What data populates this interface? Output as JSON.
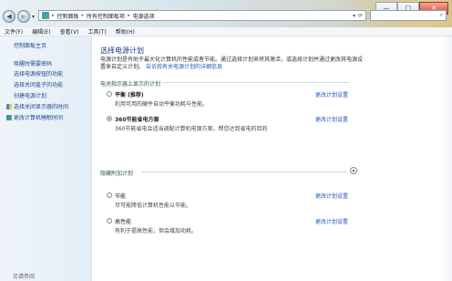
{
  "address_bar": {
    "crumbs": [
      "控制面板",
      "所有控制面板项",
      "电源选项"
    ],
    "refresh_glyph": "⟳"
  },
  "search": {
    "icon": "search-icon",
    "glyph": "⌕"
  },
  "window_controls": {
    "minimize": "—",
    "maximize": "□",
    "close": "✕"
  },
  "nav": {
    "back": "◀",
    "forward": "▶",
    "dropdown": "▾"
  },
  "menu": [
    "文件(F)",
    "编辑(E)",
    "查看(V)",
    "工具(T)",
    "帮助(H)"
  ],
  "sidebar": {
    "home": "控制面板主页",
    "items": [
      "唤醒时需要密码",
      "选择电源按钮的功能",
      "选择关闭盖子的功能",
      "创建电源计划"
    ],
    "icon_items": [
      "选择关闭显示器的时间",
      "更改计算机睡眠时间"
    ],
    "see_also": "另请参阅"
  },
  "main": {
    "title": "选择电源计划",
    "intro": "电源计划是有助于最大化计算机的性能或者节能。通过选择计划来将其激活，或选择计划并通过更改其电源设置来自定义计划。",
    "intro_link": "告诉我有关电源计划的详细信息",
    "section1": "电池指示器上显示的计划",
    "section2": "隐藏附加计划",
    "change_link": "更改计划设置",
    "plans": [
      {
        "name": "平衡 (推荐)",
        "desc": "利用可用的硬件自动平衡功耗与性能。",
        "selected": false
      },
      {
        "name": "360节能省电方案",
        "desc": "360节能省电会适当调配计算机电源方案，帮您达到省电的目的",
        "selected": true
      },
      {
        "name": "节能",
        "desc": "尽可能降低计算机性能以节能。",
        "selected": false
      },
      {
        "name": "高性能",
        "desc": "有利于提高性能，但会增加功耗。",
        "selected": false
      }
    ]
  }
}
